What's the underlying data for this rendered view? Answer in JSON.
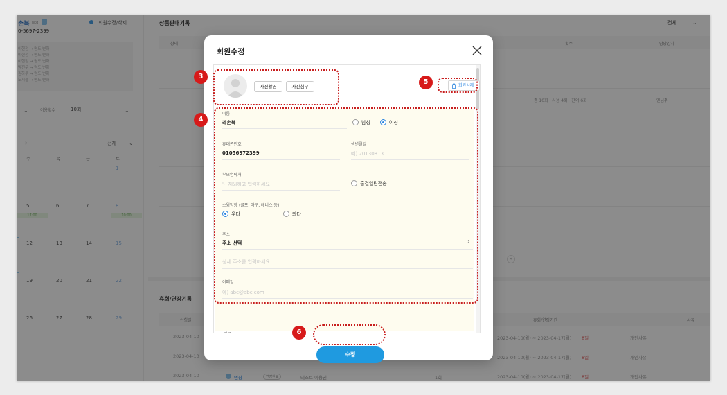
{
  "member": {
    "name": "손북",
    "name_tag": "nkg",
    "phone": "0-5697-2399",
    "edit_link": "회원수정/삭제",
    "notes": [
      "이현정 → 명도 변화",
      "이현정 → 명도 변화",
      "이현정 → 명도 변화",
      "박진우 → 명도 변화",
      "김하루 → 명도 변화",
      "노시율 → 명도 변화"
    ],
    "filter_label": "이용횟수",
    "filter_value": "10회"
  },
  "calendar": {
    "filter": "전체",
    "weekdays": [
      "수",
      "목",
      "금",
      "토"
    ],
    "dates": [
      "",
      "",
      "",
      "1",
      "5",
      "6",
      "7",
      "8",
      "12",
      "13",
      "14",
      "15",
      "19",
      "20",
      "21",
      "22",
      "26",
      "27",
      "28",
      "29",
      "",
      "",
      "",
      ""
    ],
    "slot_labels": [
      "17:00",
      "10:00"
    ]
  },
  "sales": {
    "title": "상품판매기록",
    "filter": "전체",
    "columns": [
      "상태",
      "횟수",
      "담당강사"
    ],
    "summary": "총 10회 · 사용 4회 · 잔여 6회",
    "instructor": "엔님주"
  },
  "holds": {
    "title": "휴회/연장기록",
    "columns": [
      "신청일",
      "휴회/연장기간",
      "사유"
    ],
    "rows": [
      {
        "date": "2023-04-10",
        "period": "2023-04-10(월) ~ 2023-04-17(월)",
        "days": "8일",
        "reason": "개인사유"
      },
      {
        "date": "2023-04-10",
        "period": "2023-04-10(월) ~ 2023-04-17(월)",
        "days": "8일",
        "reason": "개인사유"
      },
      {
        "date": "2023-04-10",
        "period": "2023-04-10(월) ~ 2023-04-17(월)",
        "days": "8일",
        "reason": "개인사유"
      }
    ],
    "last_row_status": "연장",
    "last_row_tag": "연장완료",
    "last_row_product": "테스트 이용권",
    "last_row_count": "1회"
  },
  "modal": {
    "title": "회원수정",
    "photo_take": "사진촬영",
    "photo_attach": "사진첨부",
    "delete_member": "회원삭제",
    "name_label": "이름",
    "name_value": "레손북",
    "gender_male": "남성",
    "gender_female": "여성",
    "phone_label": "휴대폰번호",
    "phone_value": "01056972399",
    "birth_label": "생년월일",
    "birth_placeholder": "예) 20130813",
    "parent_label": "부모연락처",
    "parent_placeholder": "'-' 제외하고 입력하세요",
    "attendance_notice": "출결알림전송",
    "swing_label": "스윙방향 (골프, 야구, 테니스 등)",
    "swing_right": "우타",
    "swing_left": "좌타",
    "address_label": "주소",
    "address_value": "주소 선택",
    "address_detail_placeholder": "상세 주소를 입력하세요.",
    "email_label": "이메일",
    "email_placeholder": "예) abc@abc.com",
    "next_label": "메모",
    "submit": "수정"
  },
  "badges": [
    "3",
    "4",
    "5",
    "6"
  ],
  "colors": {
    "accent": "#1f9ae0",
    "highlight_border": "#c81e1e",
    "form_background": "#fefcef"
  }
}
